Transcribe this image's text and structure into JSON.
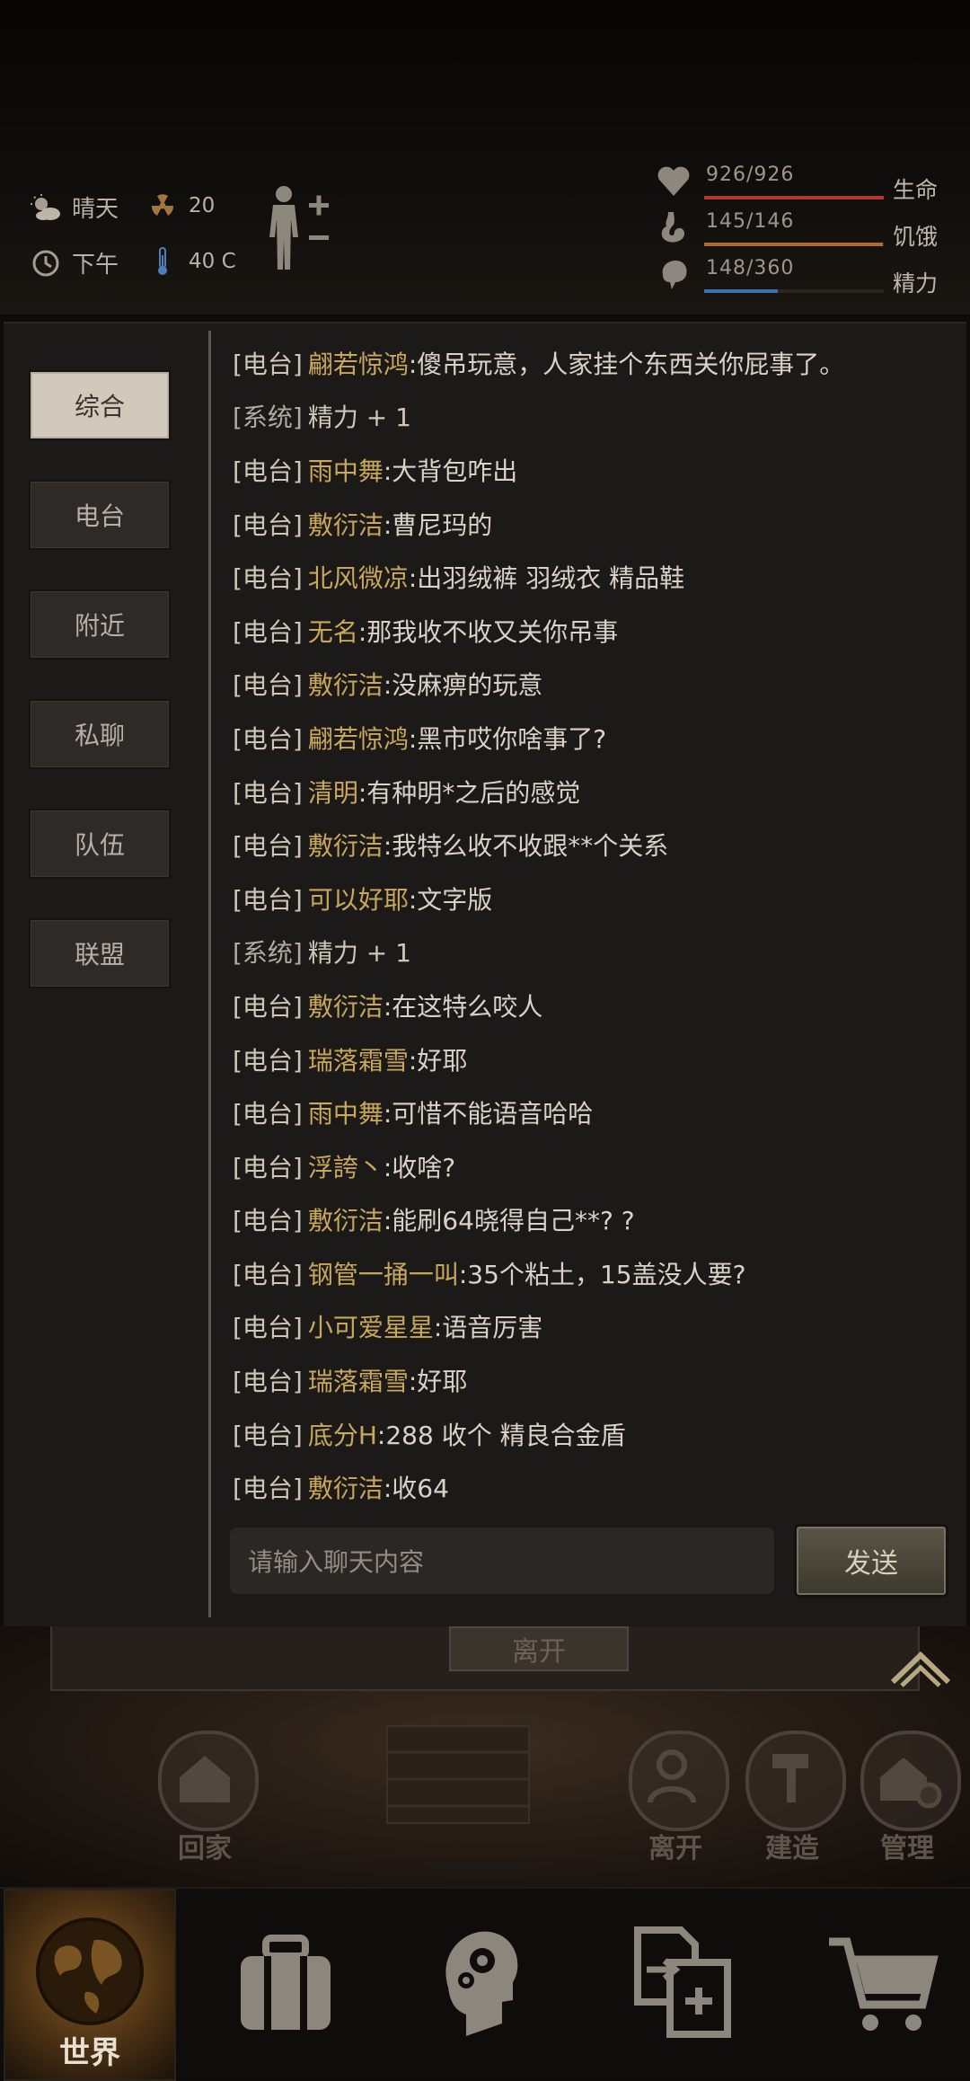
{
  "status": {
    "weather": "晴天",
    "radiation": "20",
    "time_of_day": "下午",
    "temperature": "40 C"
  },
  "vitals": [
    {
      "icon": "heart-icon",
      "value": "926/926",
      "label": "生命",
      "ratio": 1.0,
      "color": "#b2382c"
    },
    {
      "icon": "stomach-icon",
      "value": "145/146",
      "label": "饥饿",
      "ratio": 0.993,
      "color": "#b06a2a"
    },
    {
      "icon": "brain-icon",
      "value": "148/360",
      "label": "精力",
      "ratio": 0.411,
      "color": "#3f6fb0"
    }
  ],
  "tabs": [
    "综合",
    "电台",
    "附近",
    "私聊",
    "队伍",
    "联盟"
  ],
  "active_tab": "综合",
  "messages": [
    {
      "ch": "[电台]",
      "who": "翩若惊鸿",
      "txt": ":傻吊玩意，人家挂个东西关你屁事了。"
    },
    {
      "ch": "[系统]",
      "who": "",
      "txt": "精力 + 1",
      "sys": true
    },
    {
      "ch": "[电台]",
      "who": "雨中舞",
      "txt": ":大背包咋出"
    },
    {
      "ch": "[电台]",
      "who": "敷衍洁",
      "txt": ":曹尼玛的"
    },
    {
      "ch": "[电台]",
      "who": "北风微凉",
      "txt": ":出羽绒裤 羽绒衣 精品鞋"
    },
    {
      "ch": "[电台]",
      "who": "无名",
      "txt": ":那我收不收又关你吊事"
    },
    {
      "ch": "[电台]",
      "who": "敷衍洁",
      "txt": ":没麻痹的玩意"
    },
    {
      "ch": "[电台]",
      "who": "翩若惊鸿",
      "txt": ":黑市哎你啥事了?"
    },
    {
      "ch": "[电台]",
      "who": "清明",
      "txt": ":有种明*之后的感觉"
    },
    {
      "ch": "[电台]",
      "who": "敷衍洁",
      "txt": ":我特么收不收跟**个关系"
    },
    {
      "ch": "[电台]",
      "who": "可以好耶",
      "txt": ":文字版"
    },
    {
      "ch": "[系统]",
      "who": "",
      "txt": "精力 + 1",
      "sys": true
    },
    {
      "ch": "[电台]",
      "who": "敷衍洁",
      "txt": ":在这特么咬人"
    },
    {
      "ch": "[电台]",
      "who": "瑞落霜雪",
      "txt": ":好耶"
    },
    {
      "ch": "[电台]",
      "who": "雨中舞",
      "txt": ":可惜不能语音哈哈"
    },
    {
      "ch": "[电台]",
      "who": "浮誇丶",
      "txt": ":收啥?"
    },
    {
      "ch": "[电台]",
      "who": "敷衍洁",
      "txt": ":能刷64晓得自己**? ?"
    },
    {
      "ch": "[电台]",
      "who": "钢管一捅一叫",
      "txt": ":35个粘土，15盖没人要?"
    },
    {
      "ch": "[电台]",
      "who": "小可爱星星",
      "txt": ":语音厉害"
    },
    {
      "ch": "[电台]",
      "who": "瑞落霜雪",
      "txt": ":好耶"
    },
    {
      "ch": "[电台]",
      "who": "底分H",
      "txt": ":288 收个 精良合金盾"
    },
    {
      "ch": "[电台]",
      "who": "敷衍洁",
      "txt": ":收64"
    }
  ],
  "input_placeholder": "请输入聊天内容",
  "send_label": "发送",
  "scene": {
    "leave_top": "离开",
    "buttons": [
      "回家",
      "离开",
      "建造",
      "管理"
    ]
  },
  "nav": {
    "world_label": "世界",
    "items": [
      "backpack-icon",
      "skills-icon",
      "trade-icon",
      "shop-cart-icon"
    ]
  }
}
